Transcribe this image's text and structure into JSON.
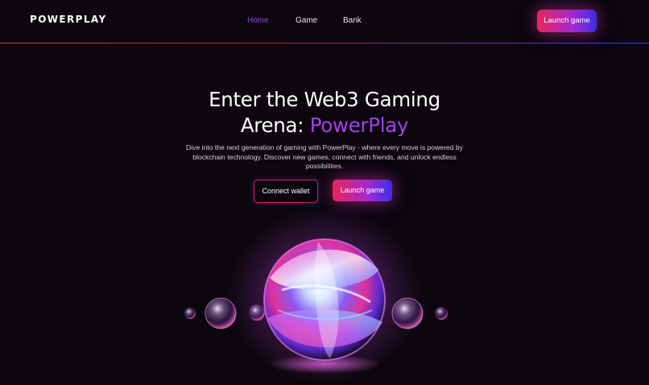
{
  "nav": {
    "logo": "POWERPLAY",
    "links": [
      {
        "label": "Home",
        "active": true
      },
      {
        "label": "Game",
        "active": false
      },
      {
        "label": "Bank",
        "active": false
      }
    ],
    "launch_label": "Launch game"
  },
  "hero": {
    "title_part1": "Enter the Web3 Gaming",
    "title_part2": "Arena: ",
    "title_accent": "PowerPlay",
    "description": "Dive into the next generation of gaming with PowerPlay - where every move is powered by blockchain technology. Discover new games, connect with friends, and unlock endless possibilities.",
    "connect_wallet_label": "Connect wallet",
    "launch_label": "Launch game"
  },
  "colors": {
    "background": "#0b070c",
    "accent_purple": "#a63ff0",
    "gradient_pink": "#e8265b",
    "gradient_blue": "#3a2ee6"
  }
}
